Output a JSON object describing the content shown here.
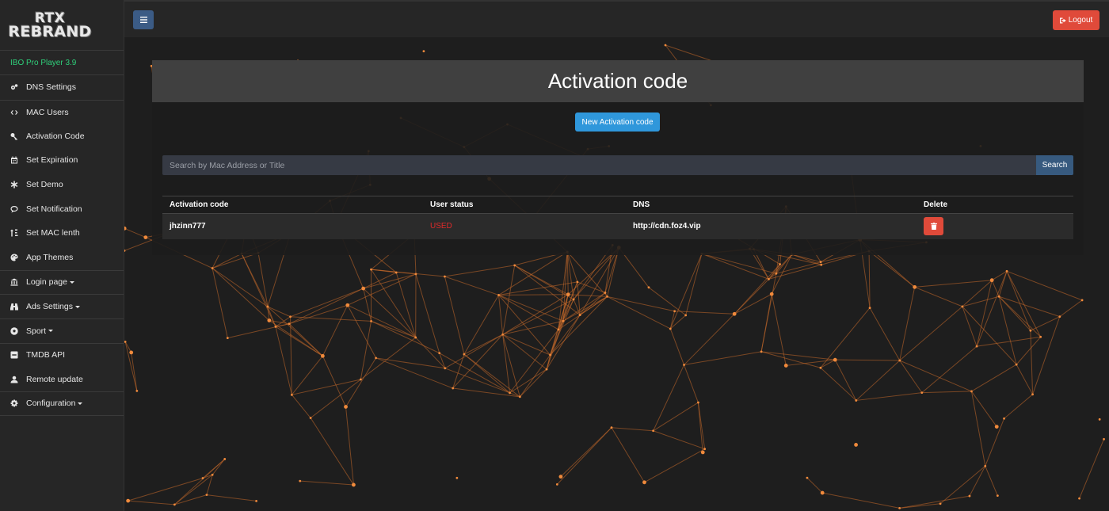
{
  "brand": {
    "line1": "RTX",
    "line2": "REBRAND"
  },
  "version_label": "IBO Pro Player 3.9",
  "sidebar": {
    "items": [
      {
        "label": "DNS Settings",
        "icon": "cogs-icon"
      },
      {
        "label": "MAC Users",
        "icon": "code-icon"
      },
      {
        "label": "Activation Code",
        "icon": "key-icon"
      },
      {
        "label": "Set Expiration",
        "icon": "calendar-icon"
      },
      {
        "label": "Set Demo",
        "icon": "asterisk-icon"
      },
      {
        "label": "Set Notification",
        "icon": "comment-icon"
      },
      {
        "label": "Set MAC lenth",
        "icon": "sort-icon"
      },
      {
        "label": "App Themes",
        "icon": "palette-icon"
      },
      {
        "label": "Login page",
        "icon": "bank-icon"
      },
      {
        "label": "Ads Settings",
        "icon": "binoculars-icon"
      },
      {
        "label": "Sport",
        "icon": "soccer-ball-icon"
      },
      {
        "label": "TMDB API",
        "icon": "minus-square-icon"
      },
      {
        "label": "Remote update",
        "icon": "user-upload-icon"
      },
      {
        "label": "Configuration",
        "icon": "gear-icon"
      }
    ]
  },
  "topbar": {
    "logout_label": "Logout"
  },
  "page": {
    "title": "Activation code",
    "new_button_label": "New Activation code",
    "search": {
      "placeholder": "Search by Mac Address or Title",
      "button_label": "Search"
    },
    "table": {
      "headers": [
        "Activation code",
        "User status",
        "DNS",
        "Delete"
      ],
      "rows": [
        {
          "code": "jhzinn777",
          "status": "USED",
          "dns": "http://cdn.foz4.vip"
        }
      ]
    }
  },
  "colors": {
    "accent_blue": "#2f97db",
    "danger_red": "#e04a3a",
    "status_used": "#e02a2a",
    "version_green": "#2fcf7a",
    "network_orange": "#e8863a"
  }
}
